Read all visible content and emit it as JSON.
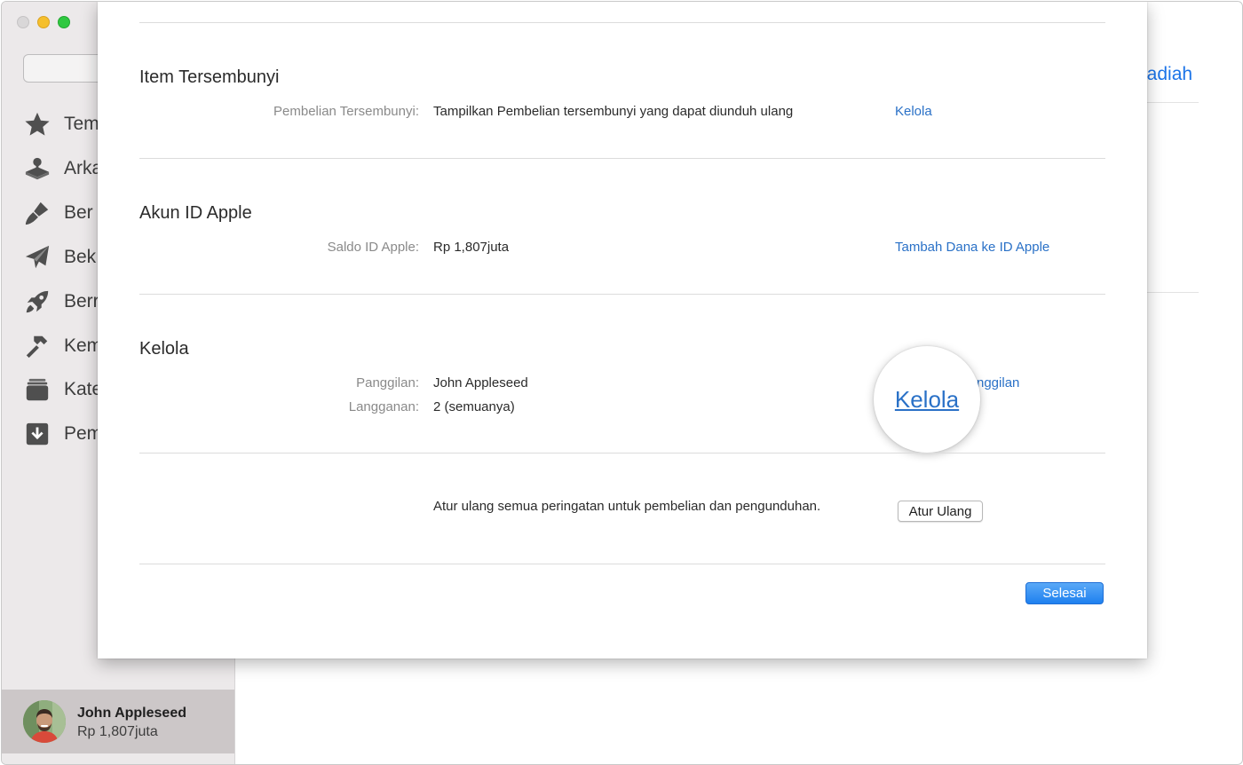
{
  "sidebar": {
    "items": [
      {
        "label": "Tem",
        "icon": "star-icon"
      },
      {
        "label": "Arka",
        "icon": "joystick-icon"
      },
      {
        "label": "Ber",
        "icon": "paintbrush-icon"
      },
      {
        "label": "Bek",
        "icon": "paper-plane-icon"
      },
      {
        "label": "Berr",
        "icon": "rocket-icon"
      },
      {
        "label": "Kem",
        "icon": "hammer-icon"
      },
      {
        "label": "Kate",
        "icon": "stack-icon"
      },
      {
        "label": "Pem",
        "icon": "download-icon"
      }
    ],
    "user": {
      "name": "John Appleseed",
      "balance": "Rp 1,807juta"
    }
  },
  "background": {
    "link_fragment": "ladiah"
  },
  "sheet": {
    "hidden": {
      "title": "Item Tersembunyi",
      "label": "Pembelian Tersembunyi:",
      "value": "Tampilkan Pembelian tersembunyi yang dapat diunduh ulang",
      "action": "Kelola"
    },
    "apple_id": {
      "title": "Akun ID Apple",
      "label": "Saldo ID Apple:",
      "value": "Rp 1,807juta",
      "action": "Tambah Dana ke ID Apple"
    },
    "manage": {
      "title": "Kelola",
      "nickname_label": "Panggilan:",
      "nickname_value": "John Appleseed",
      "subs_label": "Langganan:",
      "subs_value": "2 (semuanya)",
      "action_fragment": "nggilan",
      "magnified_link": "Kelola"
    },
    "reset": {
      "text": "Atur ulang semua peringatan untuk pembelian dan pengunduhan.",
      "button": "Atur Ulang"
    },
    "done_button": "Selesai"
  },
  "colors": {
    "accent": "#2a71c7",
    "primary_button": "#1e80ef"
  }
}
